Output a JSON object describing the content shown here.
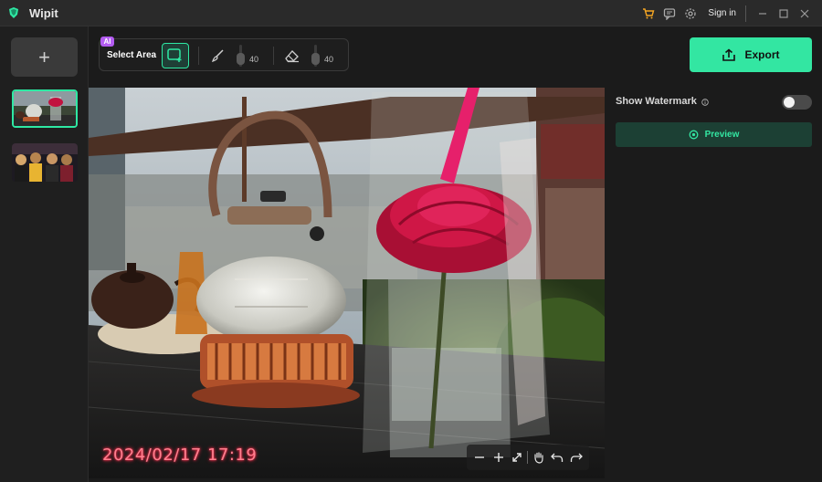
{
  "app": {
    "title": "Wipit"
  },
  "titlebar": {
    "sign_in": "Sign in",
    "icons": [
      "cart-icon",
      "feedback-icon",
      "settings-icon",
      "minimize-icon",
      "maximize-icon",
      "close-icon"
    ]
  },
  "left_panel": {
    "add_label": "+",
    "thumbnails": [
      {
        "name": "teapot-rose-photo",
        "selected": true
      },
      {
        "name": "graduation-photo",
        "selected": false
      }
    ]
  },
  "toolbar": {
    "ai_badge": "AI",
    "select_area_label": "Select Area",
    "brush_size": "40",
    "eraser_size": "40"
  },
  "export": {
    "label": "Export"
  },
  "canvas": {
    "timestamp": "2024/02/17 17:19",
    "controls": [
      "zoom-out-icon",
      "zoom-in-icon",
      "fit-screen-icon",
      "pan-hand-icon",
      "undo-icon",
      "redo-icon"
    ]
  },
  "right_panel": {
    "watermark_label": "Show Watermark",
    "watermark_enabled": false,
    "preview_label": "Preview"
  },
  "colors": {
    "accent": "#33e6a2",
    "background": "#1b1b1b",
    "ai_badge": "#b35cf0"
  }
}
